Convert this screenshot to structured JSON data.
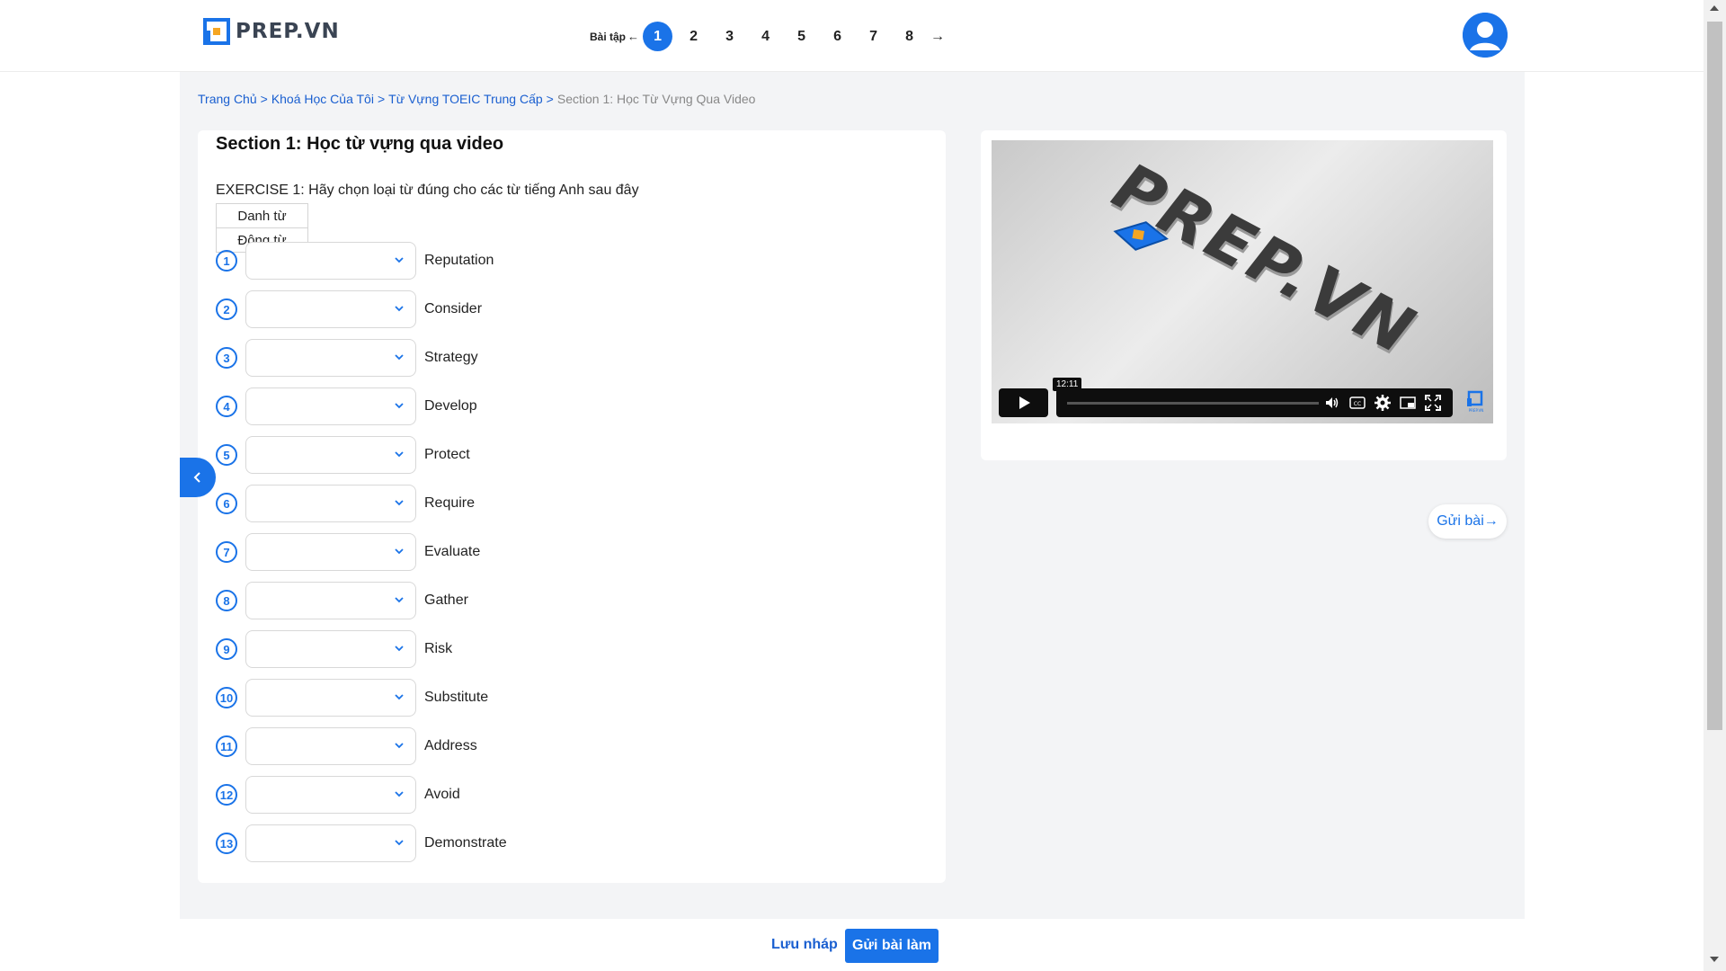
{
  "header": {
    "logo_text": "PREP.VN",
    "exercise_nav": {
      "label": "Bài tập",
      "back_arrow": "←",
      "next_arrow": "→",
      "numbers": [
        "1",
        "2",
        "3",
        "4",
        "5",
        "6",
        "7",
        "8"
      ],
      "active": "1"
    },
    "avatar_icon": "user-avatar-icon"
  },
  "breadcrumb": {
    "items": [
      "Trang Chủ",
      "Khoá Học Của Tôi",
      "Từ Vựng TOEIC Trung Cấp"
    ],
    "separator": ">",
    "current": "Section 1: Học Từ Vựng Qua Video"
  },
  "main": {
    "section_title": "Section 1: Học từ vựng qua video",
    "exercise_title": "EXERCISE 1: Hãy chọn loại từ đúng cho các từ tiếng Anh sau đây",
    "word_types": [
      "Danh từ",
      "Động từ"
    ],
    "questions": [
      {
        "num": "1",
        "word": "Reputation"
      },
      {
        "num": "2",
        "word": "Consider"
      },
      {
        "num": "3",
        "word": "Strategy"
      },
      {
        "num": "4",
        "word": "Develop"
      },
      {
        "num": "5",
        "word": "Protect"
      },
      {
        "num": "6",
        "word": "Require"
      },
      {
        "num": "7",
        "word": "Evaluate"
      },
      {
        "num": "8",
        "word": "Gather"
      },
      {
        "num": "9",
        "word": "Risk"
      },
      {
        "num": "10",
        "word": "Substitute"
      },
      {
        "num": "11",
        "word": "Address"
      },
      {
        "num": "12",
        "word": "Avoid"
      },
      {
        "num": "13",
        "word": "Demonstrate"
      }
    ]
  },
  "video": {
    "brand_text": "PREP.VN",
    "time_tooltip": "12:11",
    "corner_logo_text": "PREP.VN"
  },
  "side": {
    "submit_label": "Gửi bài→"
  },
  "footer": {
    "draft_label": "Lưu nháp",
    "submit_label": "Gửi bài làm"
  },
  "colors": {
    "accent": "#1a73e8",
    "link": "#1a5fd0",
    "page_bg": "#f3f4f6"
  }
}
